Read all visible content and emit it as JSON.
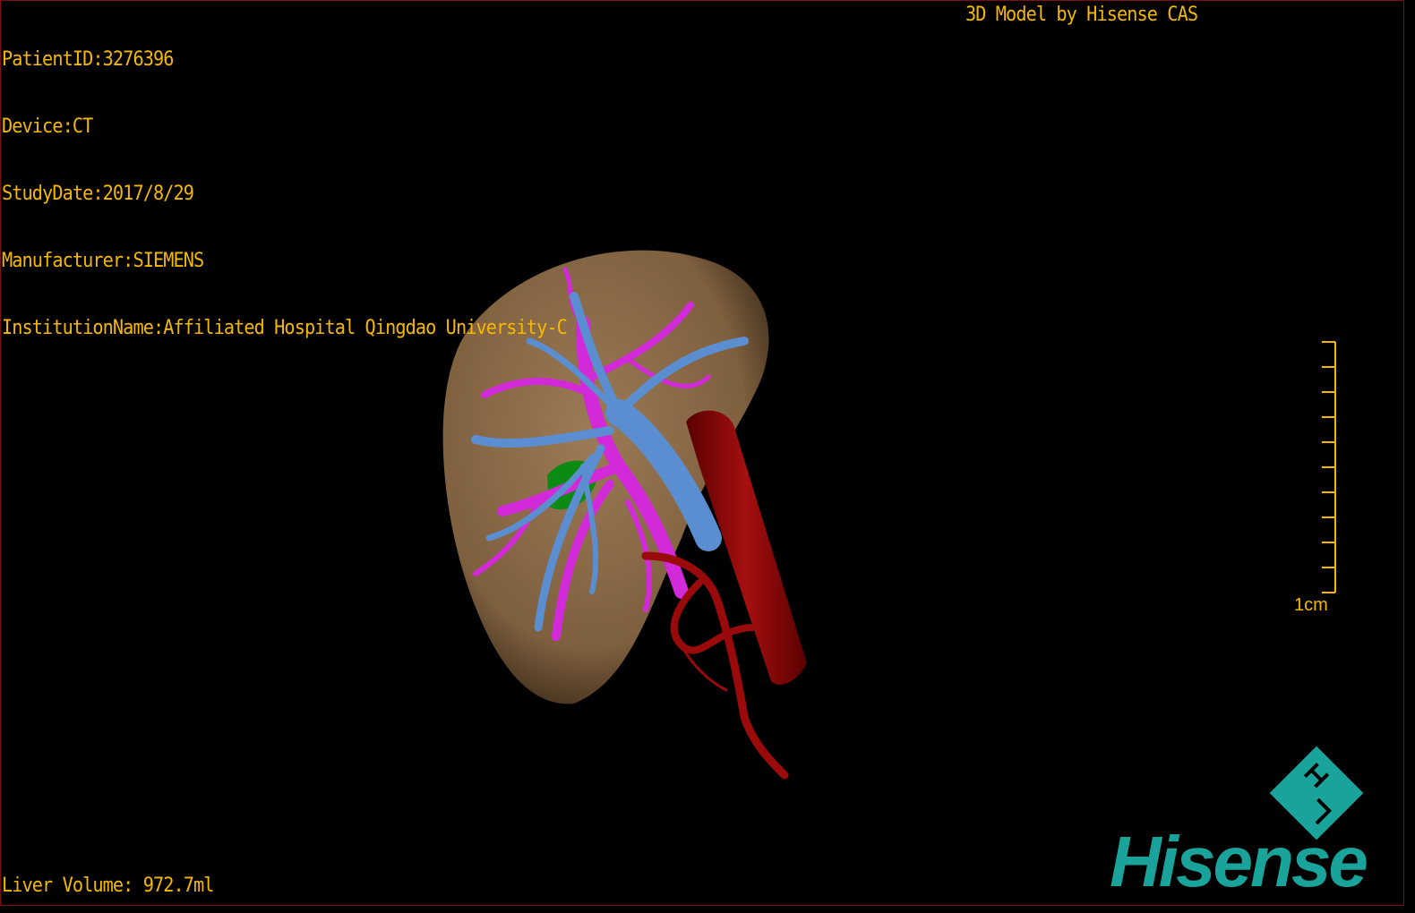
{
  "overlay": {
    "patient_id": "PatientID:3276396",
    "device": "Device:CT",
    "study_date": "StudyDate:2017/8/29",
    "manufacturer": "Manufacturer:SIEMENS",
    "institution": "InstitutionName:Affiliated Hospital Qingdao University-C",
    "model_credit": "3D Model by Hisense CAS",
    "liver_volume": "Liver Volume: 972.7ml"
  },
  "scale_bar": {
    "label": "1cm",
    "ticks": 10
  },
  "logo": {
    "text": "Hisense"
  },
  "colors": {
    "overlay_text": "#f5b800",
    "liver": "#8c6a45",
    "portal_vein": "#d22ad8",
    "hepatic_vein": "#5b8ed0",
    "artery": "#9a0a0a",
    "gallbladder": "#0b8a14",
    "logo": "#1aa39a",
    "border": "#7a1010"
  }
}
